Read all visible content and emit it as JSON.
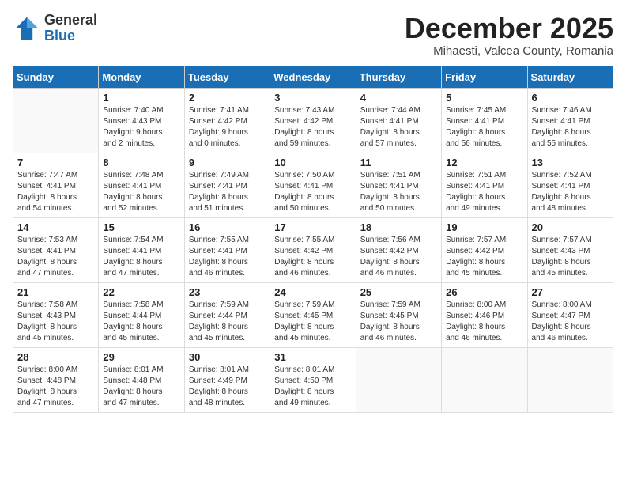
{
  "logo": {
    "general": "General",
    "blue": "Blue"
  },
  "title": {
    "month": "December 2025",
    "location": "Mihaesti, Valcea County, Romania"
  },
  "days": [
    "Sunday",
    "Monday",
    "Tuesday",
    "Wednesday",
    "Thursday",
    "Friday",
    "Saturday"
  ],
  "weeks": [
    [
      {
        "day": "",
        "info": ""
      },
      {
        "day": "1",
        "info": "Sunrise: 7:40 AM\nSunset: 4:43 PM\nDaylight: 9 hours\nand 2 minutes."
      },
      {
        "day": "2",
        "info": "Sunrise: 7:41 AM\nSunset: 4:42 PM\nDaylight: 9 hours\nand 0 minutes."
      },
      {
        "day": "3",
        "info": "Sunrise: 7:43 AM\nSunset: 4:42 PM\nDaylight: 8 hours\nand 59 minutes."
      },
      {
        "day": "4",
        "info": "Sunrise: 7:44 AM\nSunset: 4:41 PM\nDaylight: 8 hours\nand 57 minutes."
      },
      {
        "day": "5",
        "info": "Sunrise: 7:45 AM\nSunset: 4:41 PM\nDaylight: 8 hours\nand 56 minutes."
      },
      {
        "day": "6",
        "info": "Sunrise: 7:46 AM\nSunset: 4:41 PM\nDaylight: 8 hours\nand 55 minutes."
      }
    ],
    [
      {
        "day": "7",
        "info": "Sunrise: 7:47 AM\nSunset: 4:41 PM\nDaylight: 8 hours\nand 54 minutes."
      },
      {
        "day": "8",
        "info": "Sunrise: 7:48 AM\nSunset: 4:41 PM\nDaylight: 8 hours\nand 52 minutes."
      },
      {
        "day": "9",
        "info": "Sunrise: 7:49 AM\nSunset: 4:41 PM\nDaylight: 8 hours\nand 51 minutes."
      },
      {
        "day": "10",
        "info": "Sunrise: 7:50 AM\nSunset: 4:41 PM\nDaylight: 8 hours\nand 50 minutes."
      },
      {
        "day": "11",
        "info": "Sunrise: 7:51 AM\nSunset: 4:41 PM\nDaylight: 8 hours\nand 50 minutes."
      },
      {
        "day": "12",
        "info": "Sunrise: 7:51 AM\nSunset: 4:41 PM\nDaylight: 8 hours\nand 49 minutes."
      },
      {
        "day": "13",
        "info": "Sunrise: 7:52 AM\nSunset: 4:41 PM\nDaylight: 8 hours\nand 48 minutes."
      }
    ],
    [
      {
        "day": "14",
        "info": "Sunrise: 7:53 AM\nSunset: 4:41 PM\nDaylight: 8 hours\nand 47 minutes."
      },
      {
        "day": "15",
        "info": "Sunrise: 7:54 AM\nSunset: 4:41 PM\nDaylight: 8 hours\nand 47 minutes."
      },
      {
        "day": "16",
        "info": "Sunrise: 7:55 AM\nSunset: 4:41 PM\nDaylight: 8 hours\nand 46 minutes."
      },
      {
        "day": "17",
        "info": "Sunrise: 7:55 AM\nSunset: 4:42 PM\nDaylight: 8 hours\nand 46 minutes."
      },
      {
        "day": "18",
        "info": "Sunrise: 7:56 AM\nSunset: 4:42 PM\nDaylight: 8 hours\nand 46 minutes."
      },
      {
        "day": "19",
        "info": "Sunrise: 7:57 AM\nSunset: 4:42 PM\nDaylight: 8 hours\nand 45 minutes."
      },
      {
        "day": "20",
        "info": "Sunrise: 7:57 AM\nSunset: 4:43 PM\nDaylight: 8 hours\nand 45 minutes."
      }
    ],
    [
      {
        "day": "21",
        "info": "Sunrise: 7:58 AM\nSunset: 4:43 PM\nDaylight: 8 hours\nand 45 minutes."
      },
      {
        "day": "22",
        "info": "Sunrise: 7:58 AM\nSunset: 4:44 PM\nDaylight: 8 hours\nand 45 minutes."
      },
      {
        "day": "23",
        "info": "Sunrise: 7:59 AM\nSunset: 4:44 PM\nDaylight: 8 hours\nand 45 minutes."
      },
      {
        "day": "24",
        "info": "Sunrise: 7:59 AM\nSunset: 4:45 PM\nDaylight: 8 hours\nand 45 minutes."
      },
      {
        "day": "25",
        "info": "Sunrise: 7:59 AM\nSunset: 4:45 PM\nDaylight: 8 hours\nand 46 minutes."
      },
      {
        "day": "26",
        "info": "Sunrise: 8:00 AM\nSunset: 4:46 PM\nDaylight: 8 hours\nand 46 minutes."
      },
      {
        "day": "27",
        "info": "Sunrise: 8:00 AM\nSunset: 4:47 PM\nDaylight: 8 hours\nand 46 minutes."
      }
    ],
    [
      {
        "day": "28",
        "info": "Sunrise: 8:00 AM\nSunset: 4:48 PM\nDaylight: 8 hours\nand 47 minutes."
      },
      {
        "day": "29",
        "info": "Sunrise: 8:01 AM\nSunset: 4:48 PM\nDaylight: 8 hours\nand 47 minutes."
      },
      {
        "day": "30",
        "info": "Sunrise: 8:01 AM\nSunset: 4:49 PM\nDaylight: 8 hours\nand 48 minutes."
      },
      {
        "day": "31",
        "info": "Sunrise: 8:01 AM\nSunset: 4:50 PM\nDaylight: 8 hours\nand 49 minutes."
      },
      {
        "day": "",
        "info": ""
      },
      {
        "day": "",
        "info": ""
      },
      {
        "day": "",
        "info": ""
      }
    ]
  ]
}
